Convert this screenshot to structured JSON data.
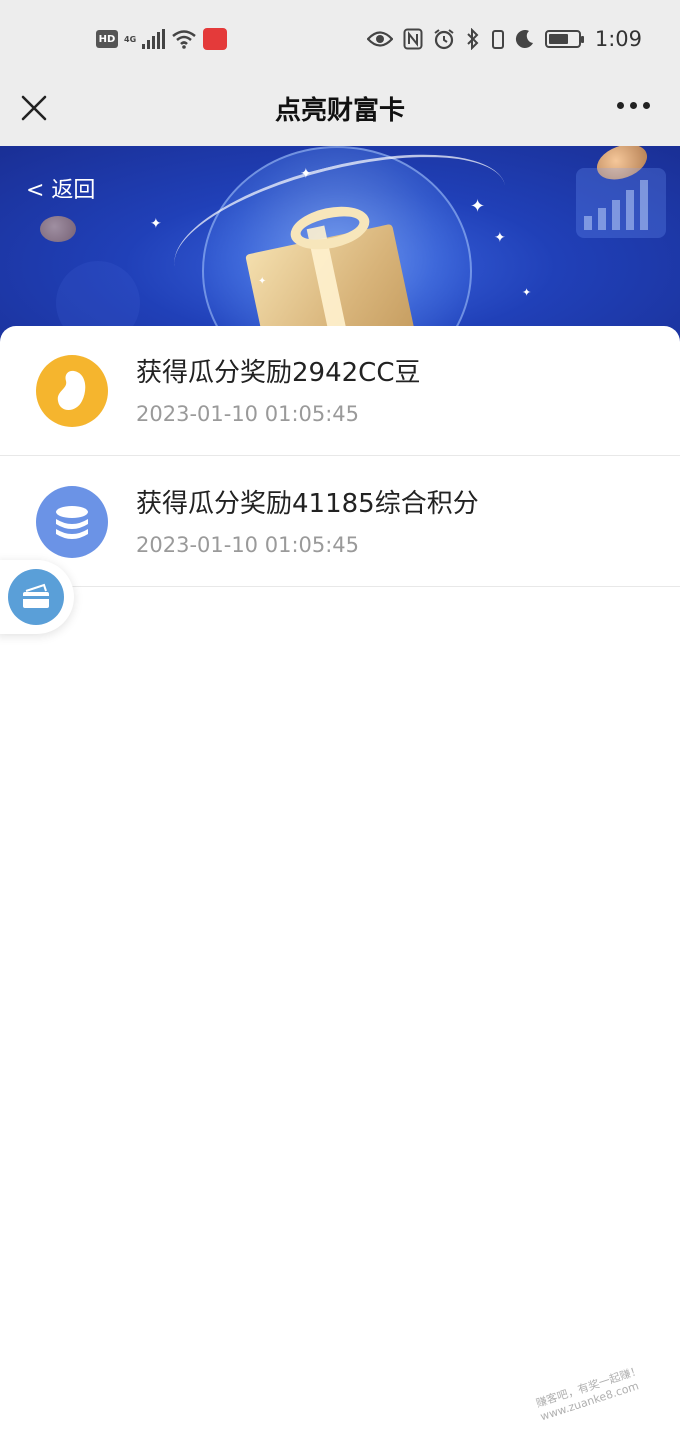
{
  "status_bar": {
    "hd": "HD",
    "network": "4G",
    "time": "1:09"
  },
  "nav": {
    "title": "点亮财富卡"
  },
  "banner": {
    "back_label": "< 返回"
  },
  "records": [
    {
      "title": "获得瓜分奖励2942CC豆",
      "time": "2023-01-10 01:05:45",
      "icon": "bean-icon",
      "icon_color": "#f5b52e"
    },
    {
      "title": "获得瓜分奖励41185综合积分",
      "time": "2023-01-10 01:05:45",
      "icon": "coin-stack-icon",
      "icon_color": "#6b93e6"
    }
  ],
  "watermark": {
    "line1": "赚客吧，有奖一起赚！",
    "line2": "www.zuanke8.com"
  },
  "colors": {
    "banner": "#2040b8",
    "nav_bg": "#ededed"
  }
}
